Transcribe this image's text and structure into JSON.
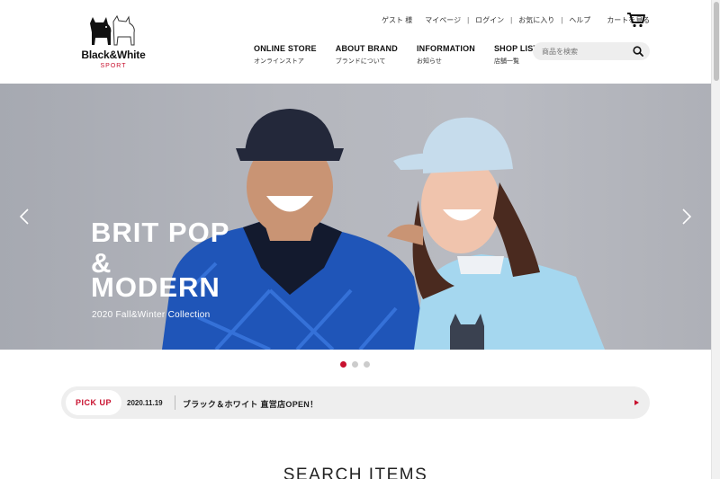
{
  "header": {
    "logo": {
      "brand": "Black&White",
      "sub": "SPORT"
    },
    "util": {
      "guest": "ゲスト 様",
      "links": [
        "マイページ",
        "ログイン",
        "お気に入り",
        "ヘルプ"
      ],
      "cart_label": "カートを見る"
    },
    "nav": [
      {
        "en": "ONLINE STORE",
        "ja": "オンラインストア"
      },
      {
        "en": "ABOUT BRAND",
        "ja": "ブランドについて"
      },
      {
        "en": "INFORMATION",
        "ja": "お知らせ"
      },
      {
        "en": "SHOP LIST",
        "ja": "店舗一覧"
      }
    ],
    "search": {
      "placeholder": "商品を検索"
    }
  },
  "hero": {
    "title_lines": [
      "BRIT POP",
      "&",
      "MODERN"
    ],
    "subtitle": "2020 Fall&Winter Collection",
    "slides": {
      "count": 3,
      "active": 0
    }
  },
  "pickup": {
    "badge": "PICK UP",
    "date": "2020.11.19",
    "text": "ブラック＆ホワイト 直営店OPEN！"
  },
  "section": {
    "title": "SEARCH ITEMS"
  },
  "colors": {
    "accent": "#c8102e",
    "bar_bg": "#eeeeee"
  },
  "icons": [
    "scottie-dogs-logo",
    "cart-icon",
    "search-icon",
    "chevron-left-icon",
    "chevron-right-icon",
    "play-icon"
  ]
}
